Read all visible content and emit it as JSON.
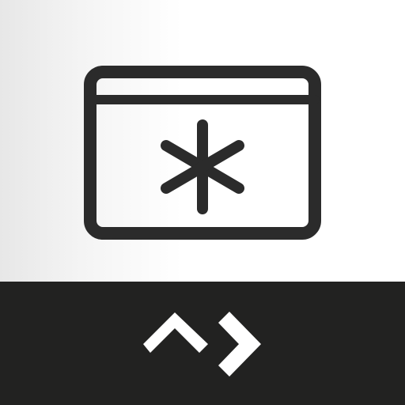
{
  "colors": {
    "top_background_light": "#ffffff",
    "top_background_shade": "#e7e7e7",
    "glyph_stroke": "#2b2b2b",
    "bottom_band": "#222221",
    "logo_fill": "#ffffff"
  },
  "icons": {
    "main": "password-window-icon",
    "asterisk": "asterisk-icon",
    "logo": "brand-logo-icon"
  }
}
